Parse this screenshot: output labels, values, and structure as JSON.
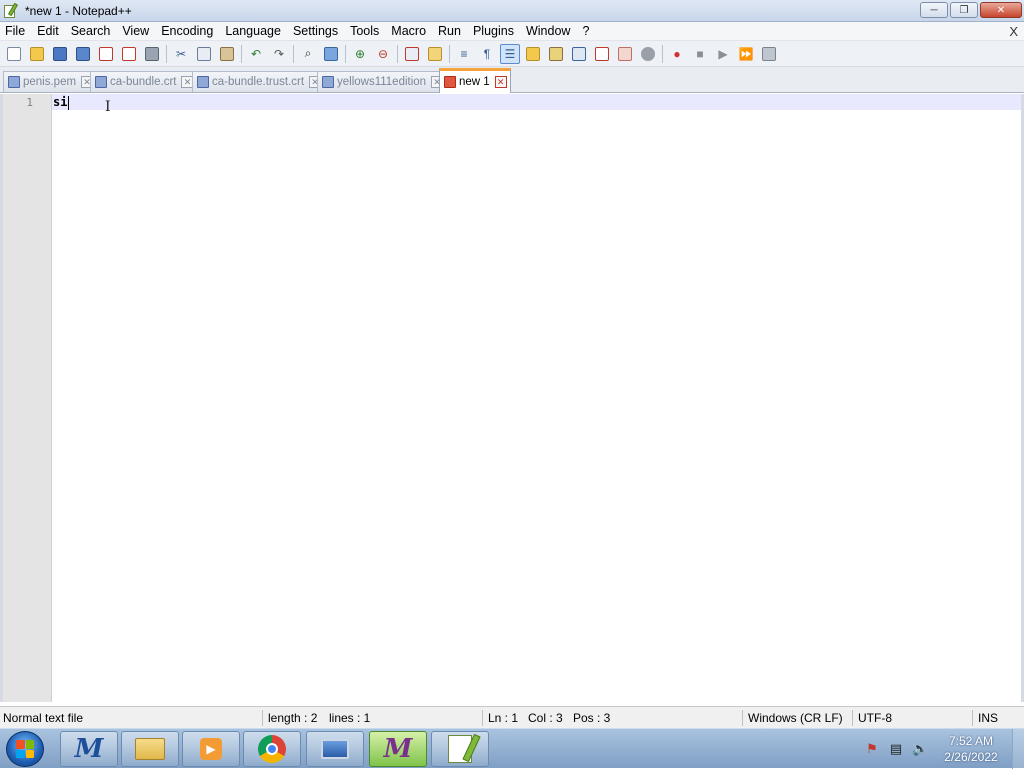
{
  "window": {
    "title": "*new 1 - Notepad++",
    "controls": {
      "minimize": "─",
      "restore": "❐",
      "close": "✕"
    }
  },
  "menu": {
    "items": [
      "File",
      "Edit",
      "Search",
      "View",
      "Encoding",
      "Language",
      "Settings",
      "Tools",
      "Macro",
      "Run",
      "Plugins",
      "Window",
      "?"
    ],
    "close_glyph": "X"
  },
  "tabs": [
    {
      "label": "penis.pem",
      "active": false
    },
    {
      "label": "ca-bundle.crt",
      "active": false
    },
    {
      "label": "ca-bundle.trust.crt",
      "active": false
    },
    {
      "label": "yellows111edition",
      "active": false
    },
    {
      "label": "new 1",
      "active": true
    }
  ],
  "editor": {
    "line_number": "1",
    "text": "si"
  },
  "status": {
    "file_type": "Normal text file",
    "length": "length : 2",
    "lines": "lines : 1",
    "ln": "Ln : 1",
    "col": "Col : 3",
    "pos": "Pos : 3",
    "eol": "Windows (CR LF)",
    "encoding": "UTF-8",
    "mode": "INS"
  },
  "taskbar": {
    "time": "7:52 AM",
    "date": "2/26/2022"
  },
  "colors": {
    "active_tab_accent": "#f5a23a",
    "current_line": "#e8e8ff",
    "gutter": "#e4e4e4"
  }
}
